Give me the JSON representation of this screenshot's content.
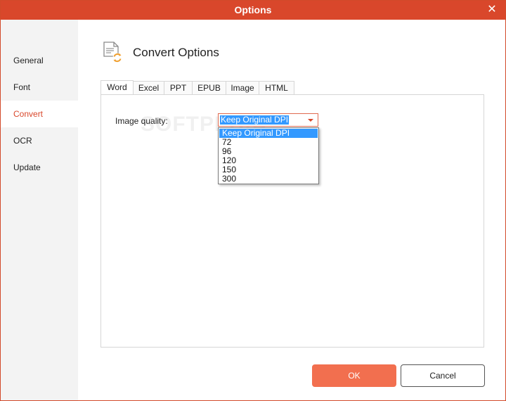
{
  "window": {
    "title": "Options",
    "close_glyph": "✕"
  },
  "sidebar": {
    "items": [
      {
        "label": "General"
      },
      {
        "label": "Font"
      },
      {
        "label": "Convert",
        "active": true
      },
      {
        "label": "OCR"
      },
      {
        "label": "Update"
      }
    ]
  },
  "header": {
    "title": "Convert Options",
    "icon": "document-convert-icon"
  },
  "tabs": [
    {
      "label": "Word",
      "active": true
    },
    {
      "label": "Excel"
    },
    {
      "label": "PPT"
    },
    {
      "label": "EPUB"
    },
    {
      "label": "Image"
    },
    {
      "label": "HTML"
    }
  ],
  "image_quality": {
    "label": "Image quality:",
    "selected": "Keep Original DPI",
    "options": [
      "Keep Original DPI",
      "72",
      "96",
      "120",
      "150",
      "300"
    ]
  },
  "watermark": "SOFTPEDIA",
  "buttons": {
    "ok": "OK",
    "cancel": "Cancel"
  },
  "colors": {
    "accent": "#d9472b",
    "ok_button": "#f26f4f",
    "selection": "#3399ff"
  }
}
